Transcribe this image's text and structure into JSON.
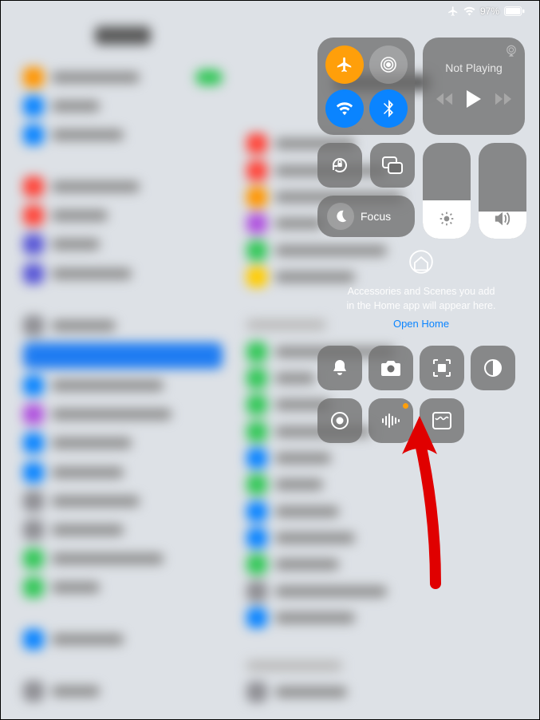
{
  "status": {
    "battery_pct": "97%"
  },
  "media": {
    "title": "Not Playing"
  },
  "focus": {
    "label": "Focus"
  },
  "home": {
    "line1": "Accessories and Scenes you add",
    "line2": "in the Home app will appear here.",
    "link": "Open Home"
  },
  "sliders": {
    "brightness_pct": 40,
    "volume_pct": 28
  }
}
